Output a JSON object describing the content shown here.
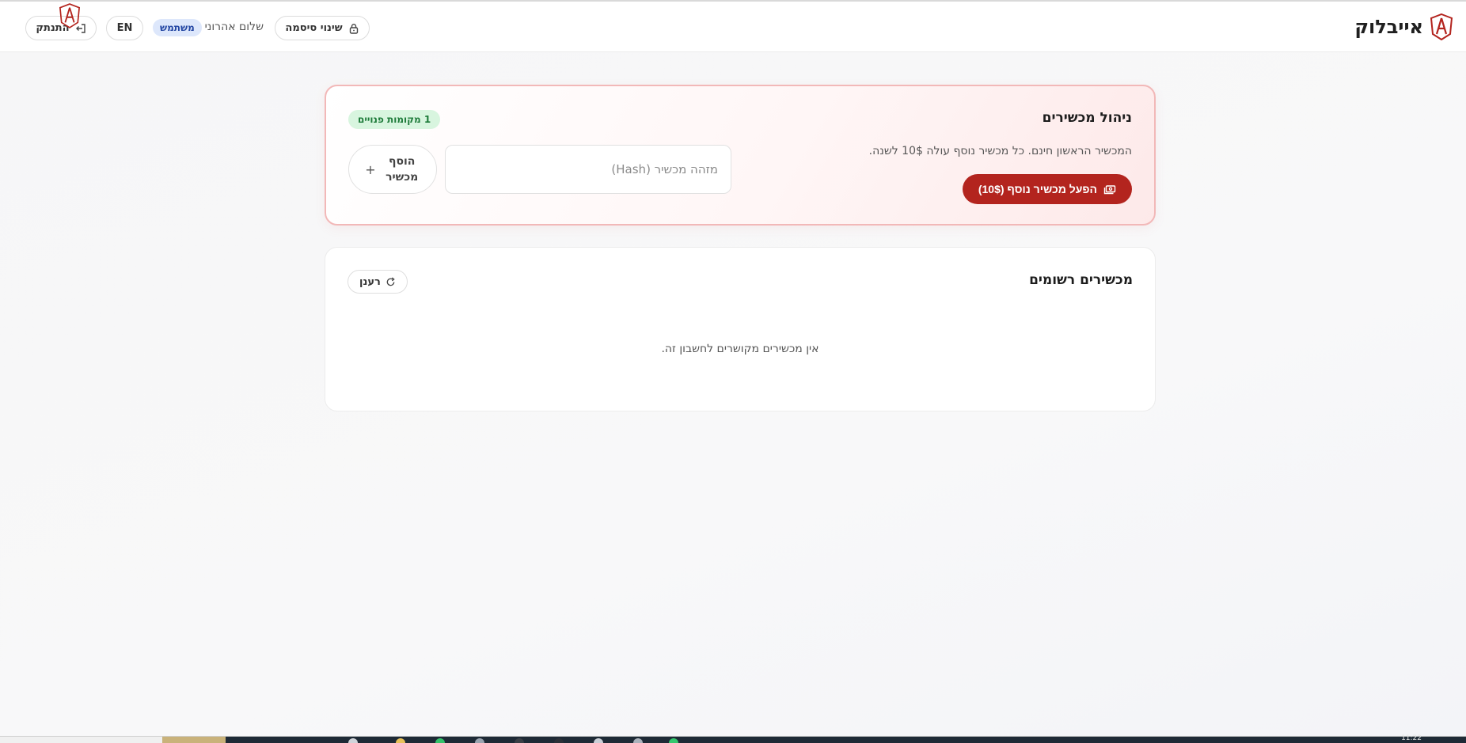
{
  "header": {
    "brand_name": "אייבלוק",
    "change_password_label": "שינוי סיסמה",
    "greeting": "שלום אהרוני",
    "role_badge": "משתמש",
    "language_label": "EN",
    "logout_label": "התנתק"
  },
  "manage_devices": {
    "title": "ניהול מכשירים",
    "slots_badge": "1 מקומות פנויים",
    "description": "המכשיר הראשון חינם. כל מכשיר נוסף עולה 10$ לשנה.",
    "activate_button": "הפעל מכשיר נוסף (10$)",
    "hash_placeholder": "מזהה מכשיר (Hash)",
    "hash_value": "",
    "add_button": "הוסף מכשיר",
    "add_button_icon": "+"
  },
  "registered_devices": {
    "title": "מכשירים רשומים",
    "refresh_button": "רענן",
    "empty_message": "אין מכשירים מקושרים לחשבון זה."
  },
  "taskbar": {
    "clock": "11:22"
  },
  "colors": {
    "accent": "#b3241e",
    "manage_border": "#f2b8b8",
    "slots_badge_bg": "#d8f5df",
    "role_badge_bg": "#dde7fb"
  },
  "icons": {
    "brand": "shield-logo-icon",
    "change_password": "lock-icon",
    "logout": "logout-icon",
    "activate": "money-icon",
    "add": "plus-icon",
    "refresh": "refresh-icon"
  }
}
